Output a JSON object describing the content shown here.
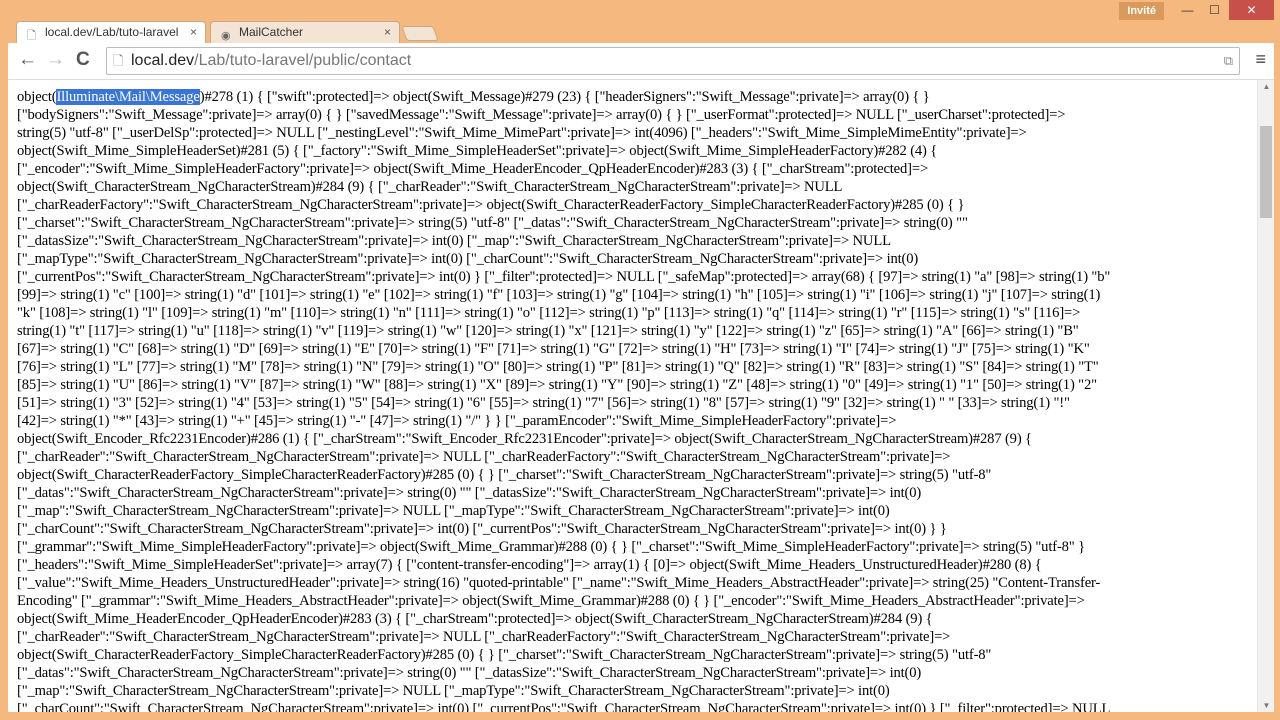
{
  "window": {
    "guest_label": "Invité",
    "min": "—",
    "max": "☐",
    "close": "✕"
  },
  "tabs": [
    {
      "title": "local.dev/Lab/tuto-laravel",
      "close": "×"
    },
    {
      "title": "MailCatcher",
      "close": "×"
    }
  ],
  "toolbar": {
    "back": "←",
    "forward": "→",
    "reload": "C",
    "url_host": "local.dev",
    "url_path": "/Lab/tuto-laravel/public/contact",
    "menu": "≡"
  },
  "content": {
    "line1_prefix": "object(",
    "line1_highlight": "Illuminate\\Mail\\Message",
    "line1_rest": ")#278 (1) { [\"swift\":protected]=> object(Swift_Message)#279 (23) { [\"headerSigners\":\"Swift_Message\":private]=> array(0) { }",
    "lines": [
      "[\"bodySigners\":\"Swift_Message\":private]=> array(0) { } [\"savedMessage\":\"Swift_Message\":private]=> array(0) { } [\"_userFormat\":protected]=> NULL [\"_userCharset\":protected]=>",
      "string(5) \"utf-8\" [\"_userDelSp\":protected]=> NULL [\"_nestingLevel\":\"Swift_Mime_MimePart\":private]=> int(4096) [\"_headers\":\"Swift_Mime_SimpleMimeEntity\":private]=>",
      "object(Swift_Mime_SimpleHeaderSet)#281 (5) { [\"_factory\":\"Swift_Mime_SimpleHeaderSet\":private]=> object(Swift_Mime_SimpleHeaderFactory)#282 (4) {",
      "[\"_encoder\":\"Swift_Mime_SimpleHeaderFactory\":private]=> object(Swift_Mime_HeaderEncoder_QpHeaderEncoder)#283 (3) { [\"_charStream\":protected]=>",
      "object(Swift_CharacterStream_NgCharacterStream)#284 (9) { [\"_charReader\":\"Swift_CharacterStream_NgCharacterStream\":private]=> NULL",
      "[\"_charReaderFactory\":\"Swift_CharacterStream_NgCharacterStream\":private]=> object(Swift_CharacterReaderFactory_SimpleCharacterReaderFactory)#285 (0) { }",
      "[\"_charset\":\"Swift_CharacterStream_NgCharacterStream\":private]=> string(5) \"utf-8\" [\"_datas\":\"Swift_CharacterStream_NgCharacterStream\":private]=> string(0) \"\"",
      "[\"_datasSize\":\"Swift_CharacterStream_NgCharacterStream\":private]=> int(0) [\"_map\":\"Swift_CharacterStream_NgCharacterStream\":private]=> NULL",
      "[\"_mapType\":\"Swift_CharacterStream_NgCharacterStream\":private]=> int(0) [\"_charCount\":\"Swift_CharacterStream_NgCharacterStream\":private]=> int(0)",
      "[\"_currentPos\":\"Swift_CharacterStream_NgCharacterStream\":private]=> int(0) } [\"_filter\":protected]=> NULL [\"_safeMap\":protected]=> array(68) { [97]=> string(1) \"a\" [98]=> string(1) \"b\"",
      "[99]=> string(1) \"c\" [100]=> string(1) \"d\" [101]=> string(1) \"e\" [102]=> string(1) \"f\" [103]=> string(1) \"g\" [104]=> string(1) \"h\" [105]=> string(1) \"i\" [106]=> string(1) \"j\" [107]=> string(1)",
      "\"k\" [108]=> string(1) \"l\" [109]=> string(1) \"m\" [110]=> string(1) \"n\" [111]=> string(1) \"o\" [112]=> string(1) \"p\" [113]=> string(1) \"q\" [114]=> string(1) \"r\" [115]=> string(1) \"s\" [116]=>",
      "string(1) \"t\" [117]=> string(1) \"u\" [118]=> string(1) \"v\" [119]=> string(1) \"w\" [120]=> string(1) \"x\" [121]=> string(1) \"y\" [122]=> string(1) \"z\" [65]=> string(1) \"A\" [66]=> string(1) \"B\"",
      "[67]=> string(1) \"C\" [68]=> string(1) \"D\" [69]=> string(1) \"E\" [70]=> string(1) \"F\" [71]=> string(1) \"G\" [72]=> string(1) \"H\" [73]=> string(1) \"I\" [74]=> string(1) \"J\" [75]=> string(1) \"K\"",
      "[76]=> string(1) \"L\" [77]=> string(1) \"M\" [78]=> string(1) \"N\" [79]=> string(1) \"O\" [80]=> string(1) \"P\" [81]=> string(1) \"Q\" [82]=> string(1) \"R\" [83]=> string(1) \"S\" [84]=> string(1) \"T\"",
      "[85]=> string(1) \"U\" [86]=> string(1) \"V\" [87]=> string(1) \"W\" [88]=> string(1) \"X\" [89]=> string(1) \"Y\" [90]=> string(1) \"Z\" [48]=> string(1) \"0\" [49]=> string(1) \"1\" [50]=> string(1) \"2\"",
      "[51]=> string(1) \"3\" [52]=> string(1) \"4\" [53]=> string(1) \"5\" [54]=> string(1) \"6\" [55]=> string(1) \"7\" [56]=> string(1) \"8\" [57]=> string(1) \"9\" [32]=> string(1) \" \" [33]=> string(1) \"!\"",
      "[42]=> string(1) \"*\" [43]=> string(1) \"+\" [45]=> string(1) \"-\" [47]=> string(1) \"/\" } } [\"_paramEncoder\":\"Swift_Mime_SimpleHeaderFactory\":private]=>",
      "object(Swift_Encoder_Rfc2231Encoder)#286 (1) { [\"_charStream\":\"Swift_Encoder_Rfc2231Encoder\":private]=> object(Swift_CharacterStream_NgCharacterStream)#287 (9) {",
      "[\"_charReader\":\"Swift_CharacterStream_NgCharacterStream\":private]=> NULL [\"_charReaderFactory\":\"Swift_CharacterStream_NgCharacterStream\":private]=>",
      "object(Swift_CharacterReaderFactory_SimpleCharacterReaderFactory)#285 (0) { } [\"_charset\":\"Swift_CharacterStream_NgCharacterStream\":private]=> string(5) \"utf-8\"",
      "[\"_datas\":\"Swift_CharacterStream_NgCharacterStream\":private]=> string(0) \"\" [\"_datasSize\":\"Swift_CharacterStream_NgCharacterStream\":private]=> int(0)",
      "[\"_map\":\"Swift_CharacterStream_NgCharacterStream\":private]=> NULL [\"_mapType\":\"Swift_CharacterStream_NgCharacterStream\":private]=> int(0)",
      "[\"_charCount\":\"Swift_CharacterStream_NgCharacterStream\":private]=> int(0) [\"_currentPos\":\"Swift_CharacterStream_NgCharacterStream\":private]=> int(0) } }",
      "[\"_grammar\":\"Swift_Mime_SimpleHeaderFactory\":private]=> object(Swift_Mime_Grammar)#288 (0) { } [\"_charset\":\"Swift_Mime_SimpleHeaderFactory\":private]=> string(5) \"utf-8\" }",
      "[\"_headers\":\"Swift_Mime_SimpleHeaderSet\":private]=> array(7) { [\"content-transfer-encoding\"]=> array(1) { [0]=> object(Swift_Mime_Headers_UnstructuredHeader)#280 (8) {",
      "[\"_value\":\"Swift_Mime_Headers_UnstructuredHeader\":private]=> string(16) \"quoted-printable\" [\"_name\":\"Swift_Mime_Headers_AbstractHeader\":private]=> string(25) \"Content-Transfer-",
      "Encoding\" [\"_grammar\":\"Swift_Mime_Headers_AbstractHeader\":private]=> object(Swift_Mime_Grammar)#288 (0) { } [\"_encoder\":\"Swift_Mime_Headers_AbstractHeader\":private]=>",
      "object(Swift_Mime_HeaderEncoder_QpHeaderEncoder)#283 (3) { [\"_charStream\":protected]=> object(Swift_CharacterStream_NgCharacterStream)#284 (9) {",
      "[\"_charReader\":\"Swift_CharacterStream_NgCharacterStream\":private]=> NULL [\"_charReaderFactory\":\"Swift_CharacterStream_NgCharacterStream\":private]=>",
      "object(Swift_CharacterReaderFactory_SimpleCharacterReaderFactory)#285 (0) { } [\"_charset\":\"Swift_CharacterStream_NgCharacterStream\":private]=> string(5) \"utf-8\"",
      "[\"_datas\":\"Swift_CharacterStream_NgCharacterStream\":private]=> string(0) \"\" [\"_datasSize\":\"Swift_CharacterStream_NgCharacterStream\":private]=> int(0)",
      "[\"_map\":\"Swift_CharacterStream_NgCharacterStream\":private]=> NULL [\"_mapType\":\"Swift_CharacterStream_NgCharacterStream\":private]=> int(0)",
      "[\"_charCount\":\"Swift_CharacterStream_NgCharacterStream\":private]=> int(0) [\"_currentPos\":\"Swift_CharacterStream_NgCharacterStream\":private]=> int(0) } [\"_filter\":protected]=> NULL"
    ]
  }
}
